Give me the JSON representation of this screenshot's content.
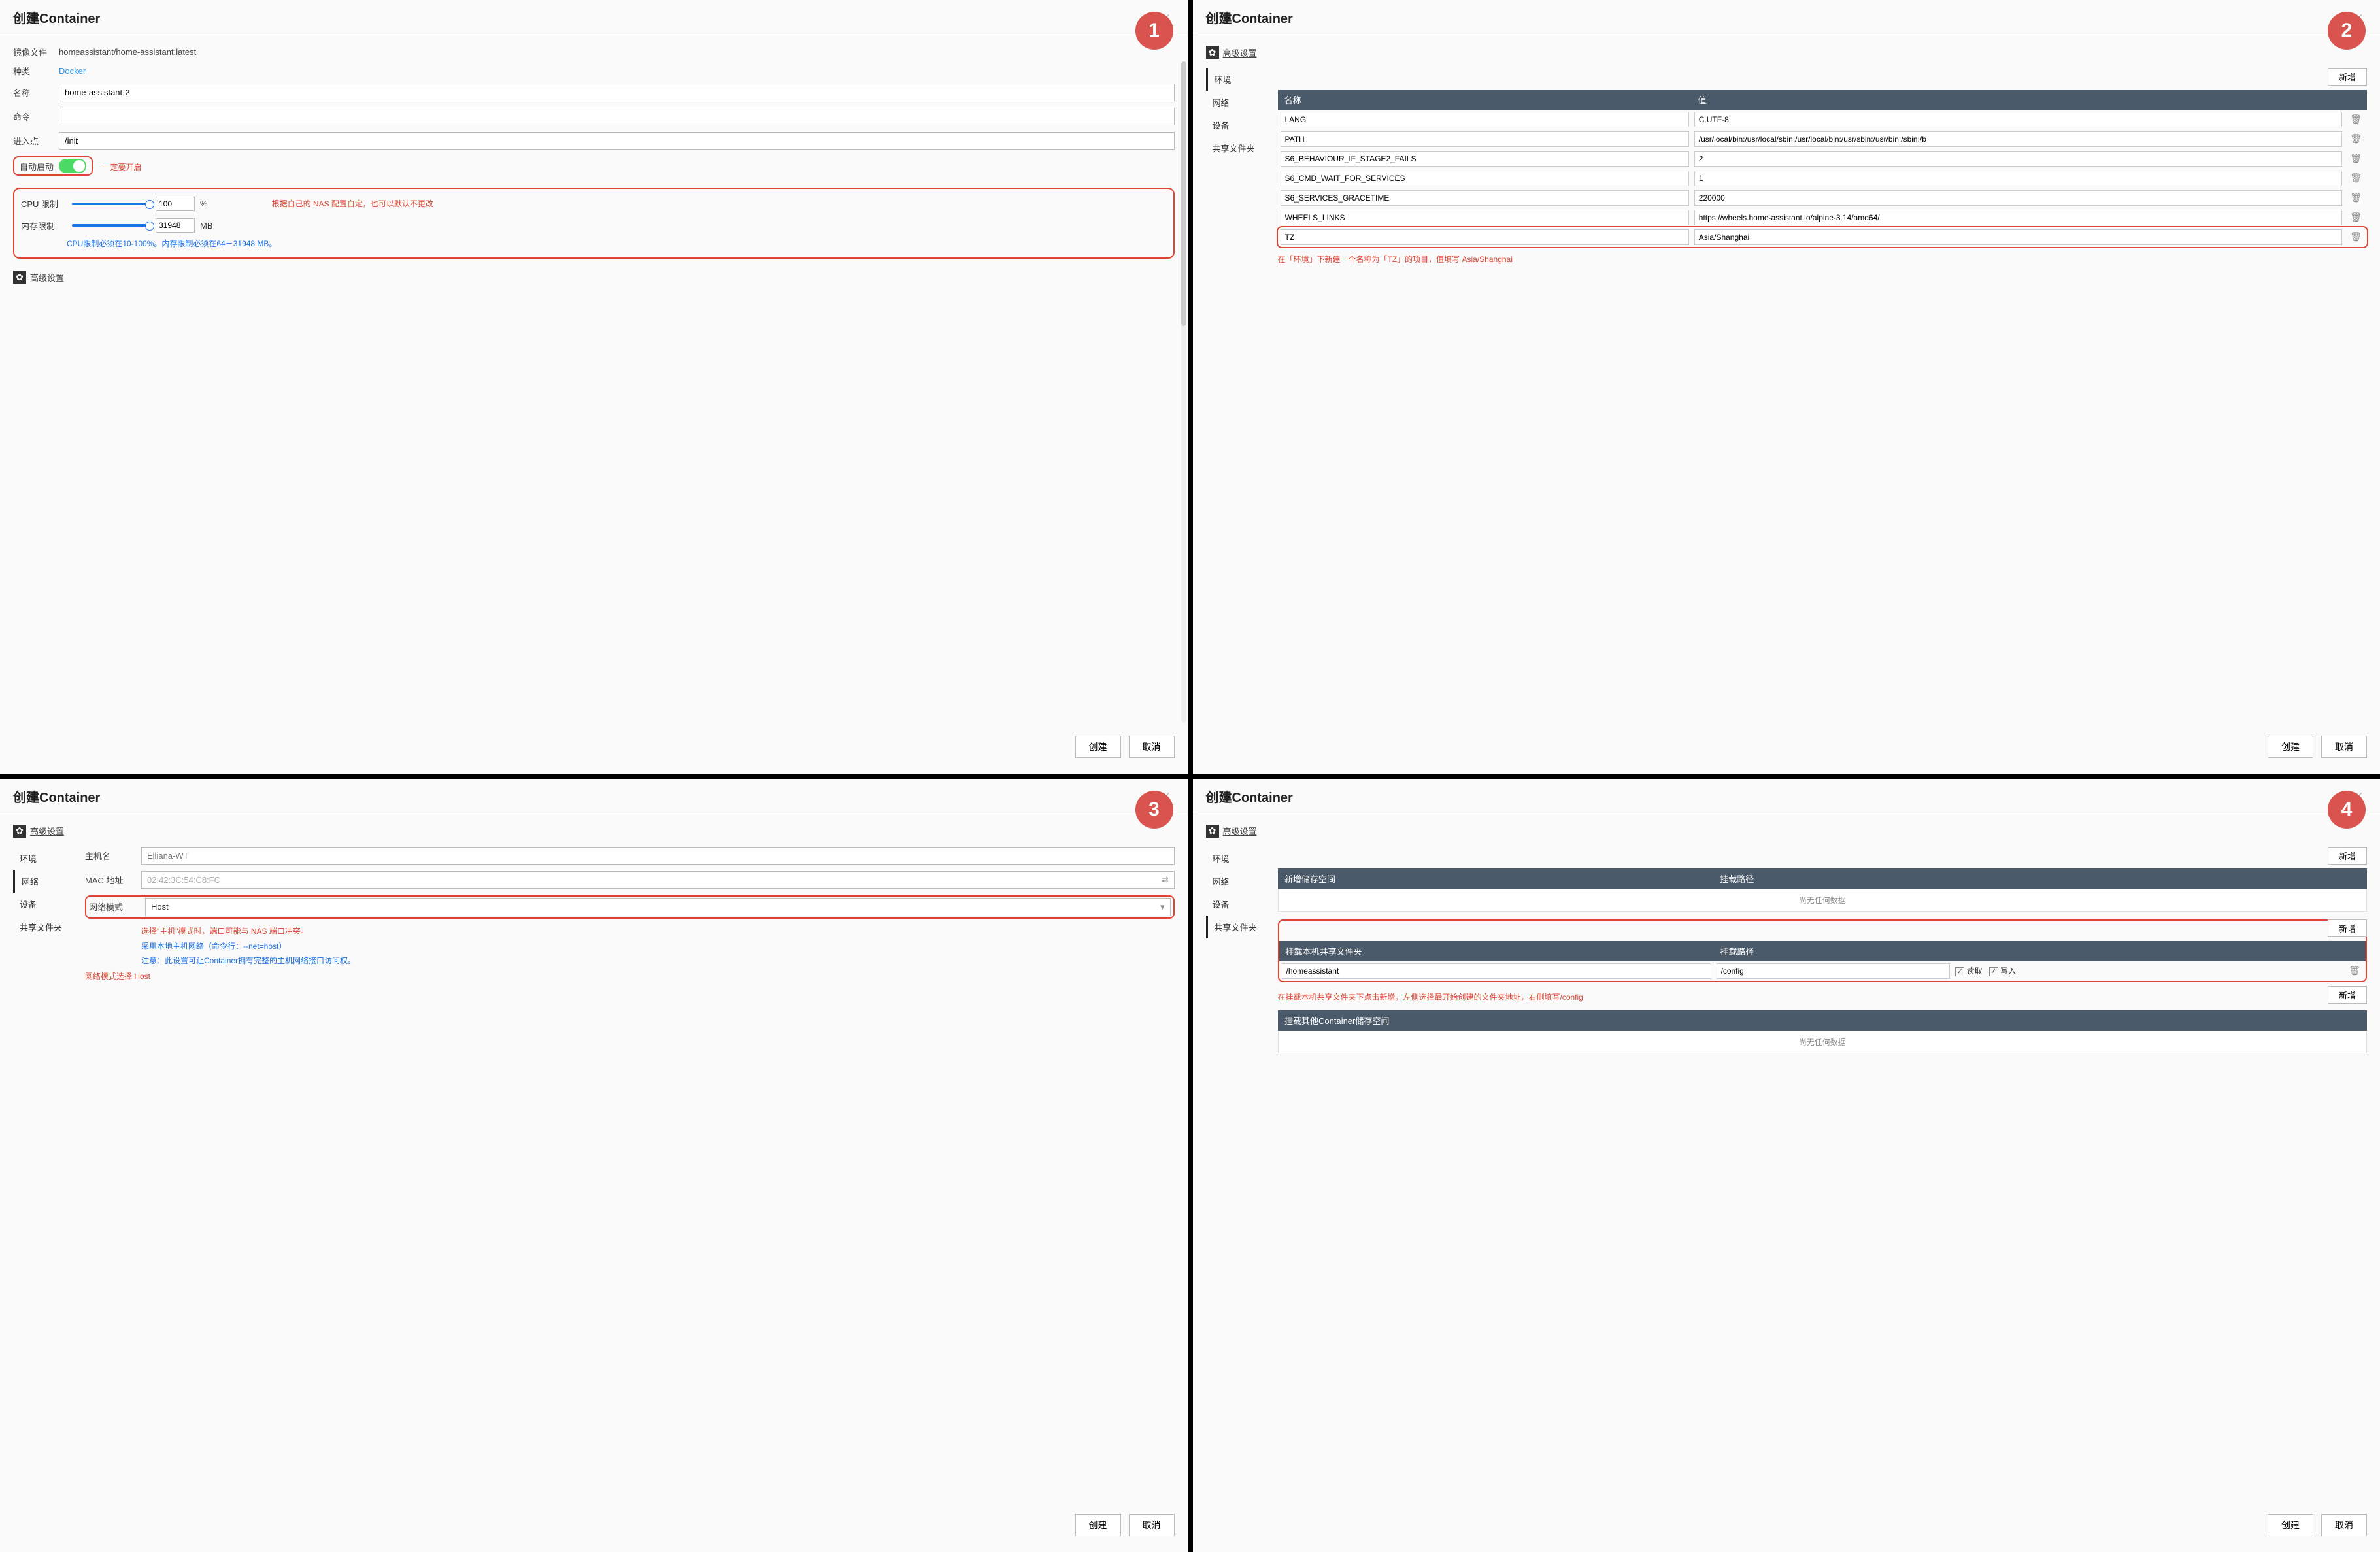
{
  "common": {
    "dialog_title": "创建Container",
    "create_btn": "创建",
    "cancel_btn": "取消",
    "advanced_settings": "高级设置",
    "add_btn": "新增",
    "sidebar": {
      "env": "环境",
      "net": "网络",
      "dev": "设备",
      "share": "共享文件夹"
    }
  },
  "panel1": {
    "badge": "1",
    "labels": {
      "image": "镜像文件",
      "kind": "种类",
      "name": "名称",
      "cmd": "命令",
      "entry": "进入点",
      "autostart": "自动启动",
      "cpu": "CPU 限制",
      "mem": "内存限制"
    },
    "image_value": "homeassistant/home-assistant:latest",
    "kind_value": "Docker",
    "name_value": "home-assistant-2",
    "cmd_value": "",
    "entry_value": "/init",
    "autostart_note": "一定要开启",
    "cpu_value": "100",
    "cpu_unit": "%",
    "mem_value": "31948",
    "mem_unit": "MB",
    "limits_note_red": "根据自己的 NAS 配置自定，也可以默认不更改",
    "limits_note_blue": "CPU限制必须在10-100%。内存限制必须在64－31948 MB。"
  },
  "panel2": {
    "badge": "2",
    "table_headers": {
      "name": "名称",
      "value": "值"
    },
    "rows": [
      {
        "k": "LANG",
        "v": "C.UTF-8"
      },
      {
        "k": "PATH",
        "v": "/usr/local/bin:/usr/local/sbin:/usr/local/bin:/usr/sbin:/usr/bin:/sbin:/b"
      },
      {
        "k": "S6_BEHAVIOUR_IF_STAGE2_FAILS",
        "v": "2"
      },
      {
        "k": "S6_CMD_WAIT_FOR_SERVICES",
        "v": "1"
      },
      {
        "k": "S6_SERVICES_GRACETIME",
        "v": "220000"
      },
      {
        "k": "WHEELS_LINKS",
        "v": "https://wheels.home-assistant.io/alpine-3.14/amd64/"
      },
      {
        "k": "TZ",
        "v": "Asia/Shanghai"
      }
    ],
    "note": "在「环境」下新建一个名称为「TZ」的项目，值填写 Asia/Shanghai"
  },
  "panel3": {
    "badge": "3",
    "labels": {
      "host": "主机名",
      "mac": "MAC 地址",
      "mode": "网络模式"
    },
    "host_placeholder": "Elliana-WT",
    "mac_placeholder": "02:42:3C:54:C8:FC",
    "mode_value": "Host",
    "note_red1": "选择\"主机\"模式时，端口可能与 NAS 端口冲突。",
    "note_blue1": "采用本地主机网络（命令行：--net=host）",
    "note_blue2": "注意：此设置可让Container拥有完整的主机网络接口访问权。",
    "note_red2": "网络模式选择 Host"
  },
  "panel4": {
    "badge": "4",
    "section1_headers": {
      "left": "新增储存空间",
      "right": "挂载路径"
    },
    "section1_empty": "尚无任何数据",
    "section2_headers": {
      "left": "挂载本机共享文件夹",
      "right": "挂载路径"
    },
    "section2_row": {
      "left": "/homeassistant",
      "right": "/config",
      "read": "读取",
      "write": "写入"
    },
    "section2_note": "在挂载本机共享文件夹下点击新增，左侧选择最开始创建的文件夹地址，右侧填写/config",
    "section3_header": "挂载其他Container储存空间",
    "section3_empty": "尚无任何数据"
  }
}
